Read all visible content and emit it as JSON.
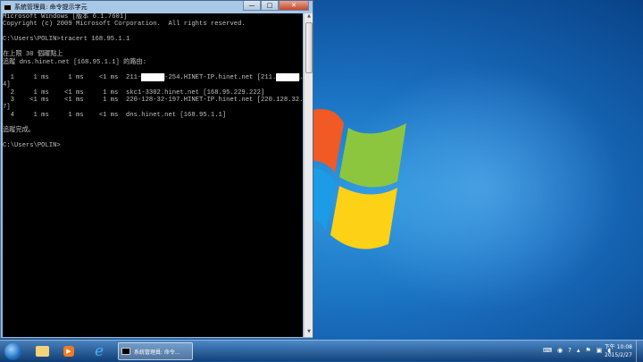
{
  "window": {
    "title": "系統管理員: 命令提示字元",
    "minimize": "—",
    "maximize": "□",
    "close": "✕"
  },
  "console": {
    "lines": [
      "Microsoft Windows [版本 6.1.7601]",
      "Copyright (c) 2009 Microsoft Corporation.  All rights reserved.",
      "",
      "C:\\Users\\POLIN>tracert 168.95.1.1",
      "",
      "在上限 30 個躍點上",
      "追蹤 dns.hinet.net [168.95.1.1] 的路由:",
      "",
      "  1     1 ms     1 ms    <1 ms  211-██████-254.HINET-IP.hinet.net [211.██████.25",
      "4]",
      "  2     1 ms    <1 ms     1 ms  skc1-3302.hinet.net [168.95.229.222]",
      "  3    <1 ms    <1 ms     1 ms  220-128-32-197.HINET-IP.hinet.net [220.128.32.19",
      "7]",
      "  4     1 ms     1 ms    <1 ms  dns.hinet.net [168.95.1.1]",
      "",
      "追蹤完成。",
      "",
      "C:\\Users\\POLIN>"
    ]
  },
  "taskbar": {
    "task_label": "系統管理員: 命令...",
    "pinned": [
      "start-button",
      "windows-explorer",
      "media-player",
      "internet-explorer"
    ]
  },
  "clock": {
    "time": "下午 10:08",
    "date": "2015/2/27"
  },
  "colors": {
    "console_bg": "#000000",
    "console_fg": "#c0c0c0"
  }
}
